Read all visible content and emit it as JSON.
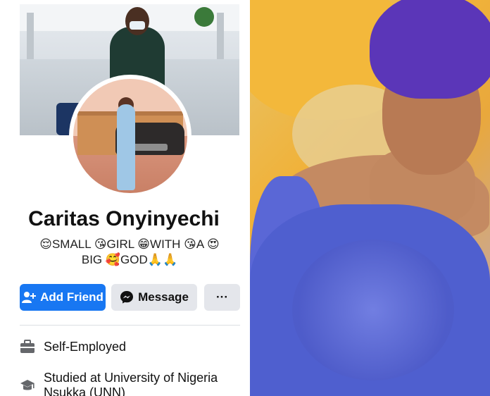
{
  "profile": {
    "name": "Caritas Onyinyechi",
    "bio_line1": "😌SMALL 😘GIRL 😁WITH 😘A 😍",
    "bio_line2": "BIG 🥰GOD🙏🙏"
  },
  "actions": {
    "add_friend": "Add Friend",
    "message": "Message",
    "more": "···"
  },
  "details": {
    "work": "Self-Employed",
    "education": "Studied at University of Nigeria Nsukka (UNN)"
  },
  "colors": {
    "facebook_blue": "#1877f2",
    "button_gray": "#e4e6eb"
  }
}
